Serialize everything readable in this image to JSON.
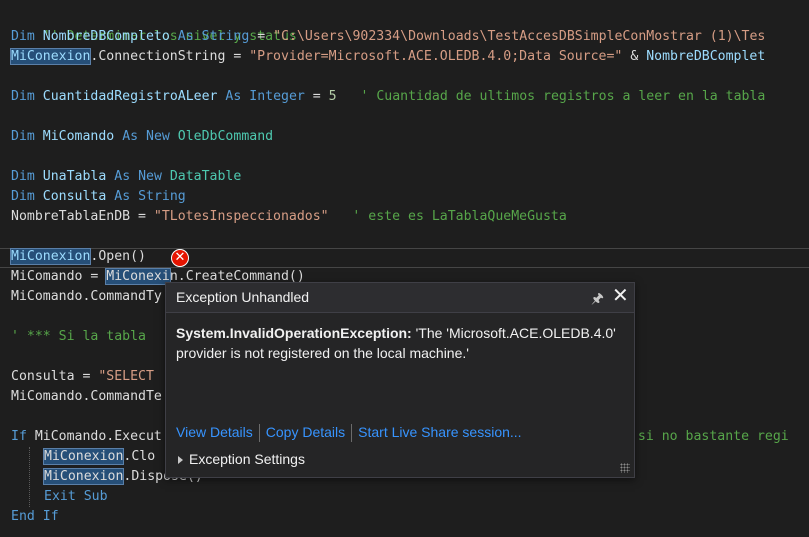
{
  "code": {
    "l1_comment": "'' Determinar los nivel y status",
    "l2_kw1": "Dim",
    "l2_id": "NombreDBCompleto",
    "l2_kw2": "As",
    "l2_kw3": "String",
    "l2_op": " = ",
    "l2_str": "\"C:\\Users\\902334\\Downloads\\TestAccesDBSimpleConMostrar (1)\\Tes",
    "l3_obj": "MiConexion",
    "l3_prop": ".ConnectionString = ",
    "l3_str": "\"Provider=Microsoft.ACE.OLEDB.4.0;Data Source=\"",
    "l3_amp": " & ",
    "l3_id": "NombreDBComplet",
    "l5_kw1": "Dim",
    "l5_id": "CuantidadRegistroALeer",
    "l5_kw2": "As",
    "l5_kw3": "Integer",
    "l5_op": " = ",
    "l5_num": "5",
    "l5_comment": "' Cuantidad de ultimos registros a leer en la tabla",
    "l7_kw1": "Dim",
    "l7_id": "MiComando",
    "l7_kw2": "As New",
    "l7_ty": "OleDbCommand",
    "l9_kw1": "Dim",
    "l9_id": "UnaTabla",
    "l9_kw2": "As New",
    "l9_ty": "DataTable",
    "l10_kw1": "Dim",
    "l10_id": "Consulta",
    "l10_kw2": "As",
    "l10_kw3": "String",
    "l11_id": "NombreTablaEnDB",
    "l11_op": " = ",
    "l11_str": "\"TLotesInspeccionados\"",
    "l11_comment": "' este es LaTablaQueMeGusta",
    "l13_obj": "MiConexion",
    "l13_rest": ".Open()",
    "l14_id": "MiComando",
    "l14_op": " = ",
    "l14_obj": "MiConexi",
    "l14_rest": "n.CreateCommand()",
    "l15_text": "MiComando.CommandTy",
    "l17_comment": "' *** Si la tabla",
    "l19_text": "Consulta = ",
    "l19_str": "\"SELECT",
    "l20_text": "MiComando.CommandTe",
    "l22_kw": "If",
    "l22_text": "MiComando.Execut",
    "l22_comment_tail": "r si no bastante regi",
    "l23_obj": "MiConexion",
    "l23_rest": ".Clo",
    "l24_obj": "MiConexion",
    "l24_rest": ".Dispose()",
    "l25_kw": "Exit Sub",
    "l26_kw": "End If"
  },
  "exception_popup": {
    "title": "Exception Unhandled",
    "exception_type": "System.InvalidOperationException:",
    "message": "'The 'Microsoft.ACE.OLEDB.4.0' provider is not registered on the local machine.'",
    "link_view_details": "View Details",
    "link_copy_details": "Copy Details",
    "link_live_share": "Start Live Share session...",
    "settings_label": "Exception Settings",
    "pin_glyph": "🖈",
    "close_glyph": "✕"
  },
  "error_glyph": "✕",
  "colors": {
    "keyword": "#569cd6",
    "type": "#4ec9b0",
    "string": "#d69d85",
    "comment": "#57a64a",
    "identifier": "#9cdcfe",
    "link": "#3794ff",
    "error": "#e51400"
  }
}
